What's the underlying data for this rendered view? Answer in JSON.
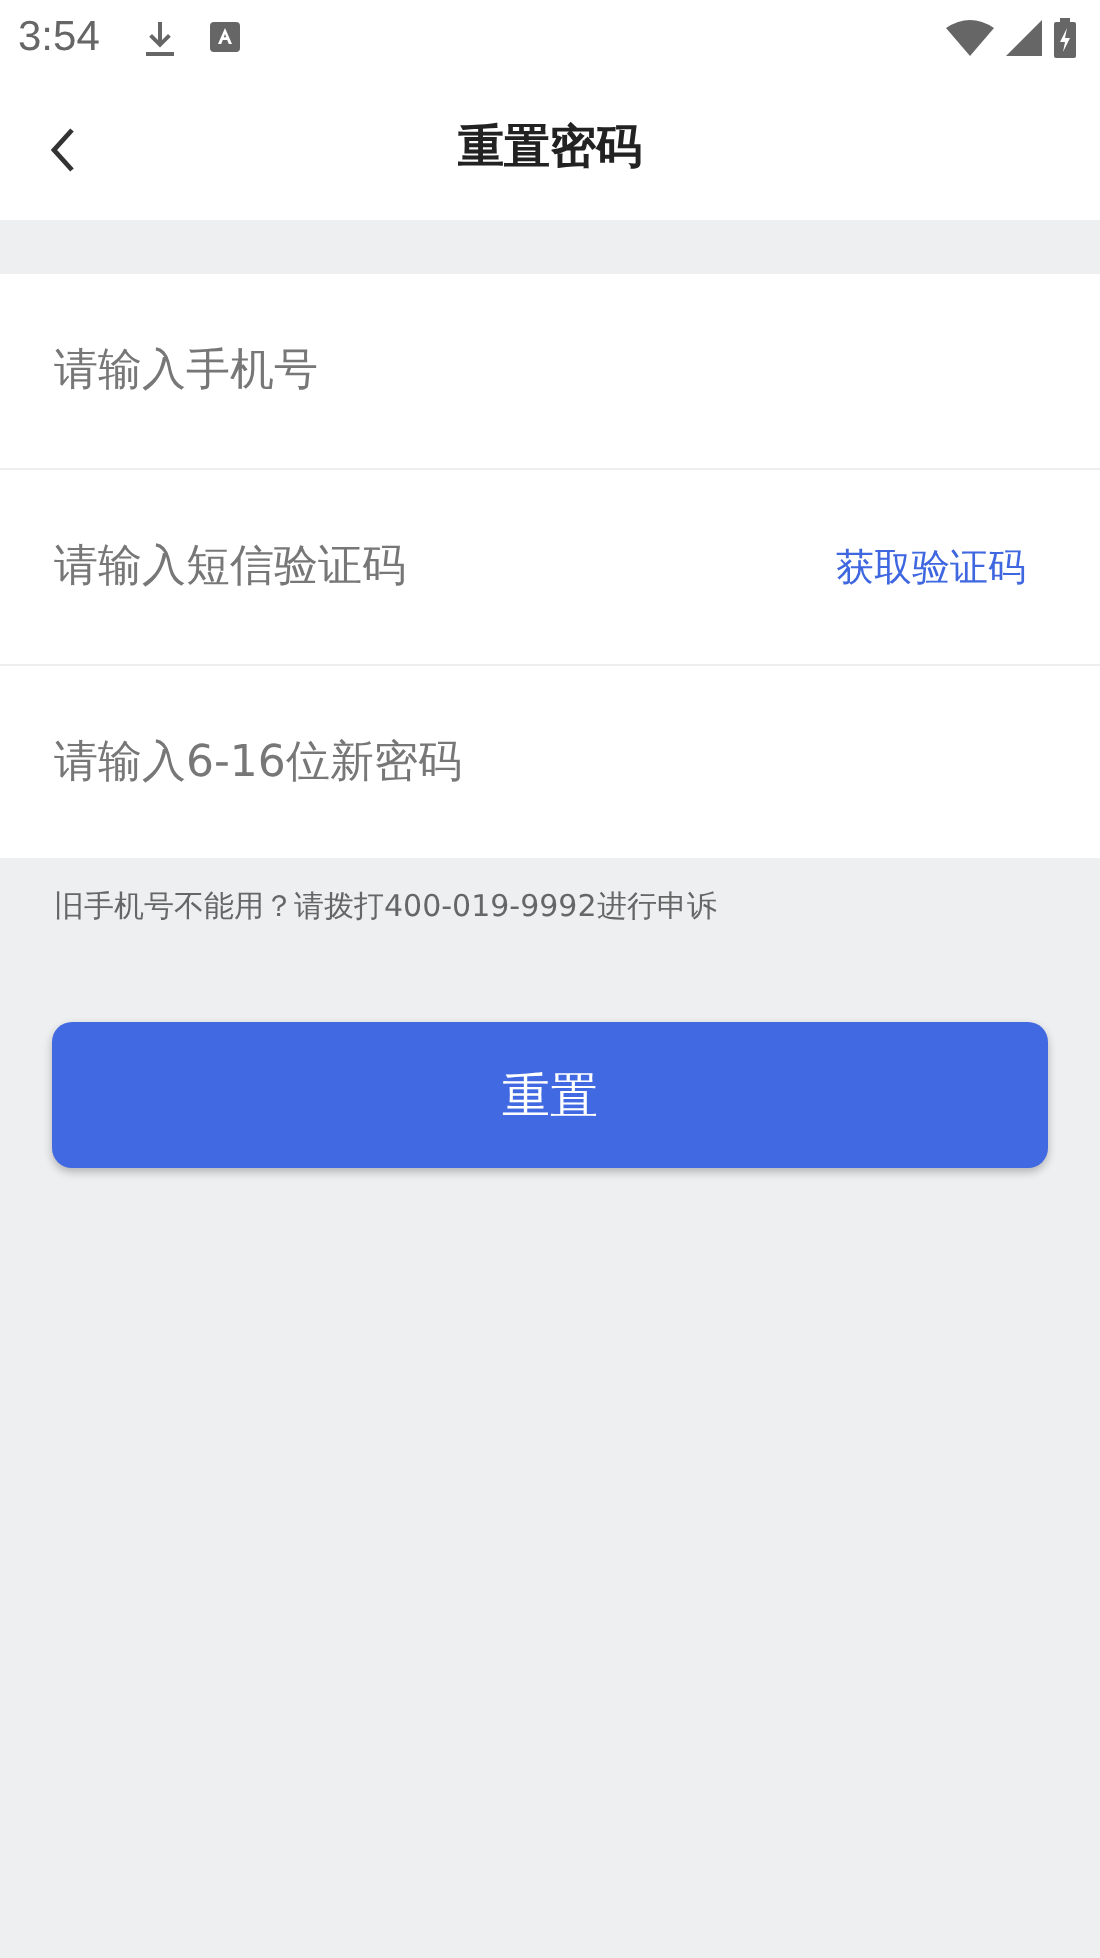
{
  "status_bar": {
    "time": "3:54"
  },
  "header": {
    "title": "重置密码"
  },
  "fields": [
    {
      "kind": "plain",
      "placeholder": "请输入手机号"
    },
    {
      "kind": "code",
      "placeholder": "请输入短信验证码",
      "action": "获取验证码"
    },
    {
      "kind": "plain",
      "placeholder": "请输入6-16位新密码"
    }
  ],
  "hint": "旧手机号不能用？请拨打400-019-9992进行申诉",
  "submit": "重置"
}
